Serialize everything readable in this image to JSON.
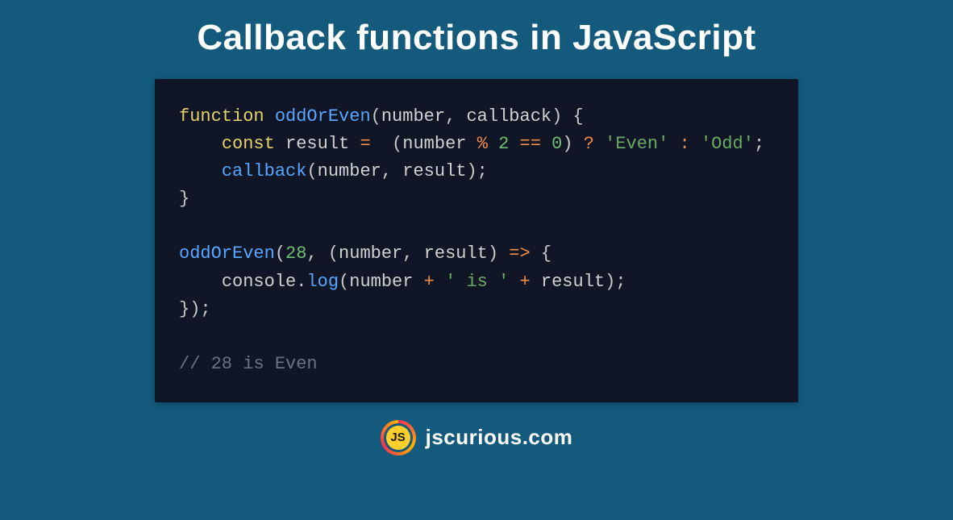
{
  "title": "Callback functions in JavaScript",
  "brand": {
    "badge": "JS",
    "domain": "jscurious.com"
  },
  "code": {
    "indent": "    ",
    "lines": [
      {
        "tokens": [
          {
            "t": "function ",
            "c": "kw"
          },
          {
            "t": "oddOrEven",
            "c": "fn"
          },
          {
            "t": "(",
            "c": "pn"
          },
          {
            "t": "number",
            "c": "id"
          },
          {
            "t": ", ",
            "c": "pn"
          },
          {
            "t": "callback",
            "c": "id"
          },
          {
            "t": ") {",
            "c": "pn"
          }
        ]
      },
      {
        "indent": 1,
        "tokens": [
          {
            "t": "const ",
            "c": "kw"
          },
          {
            "t": "result",
            "c": "id"
          },
          {
            "t": " ",
            "c": "pn"
          },
          {
            "t": "=",
            "c": "op"
          },
          {
            "t": "  (",
            "c": "pn"
          },
          {
            "t": "number",
            "c": "id"
          },
          {
            "t": " ",
            "c": "pn"
          },
          {
            "t": "%",
            "c": "op"
          },
          {
            "t": " ",
            "c": "pn"
          },
          {
            "t": "2",
            "c": "num"
          },
          {
            "t": " ",
            "c": "pn"
          },
          {
            "t": "==",
            "c": "op"
          },
          {
            "t": " ",
            "c": "pn"
          },
          {
            "t": "0",
            "c": "num"
          },
          {
            "t": ") ",
            "c": "pn"
          },
          {
            "t": "?",
            "c": "op"
          },
          {
            "t": " ",
            "c": "pn"
          },
          {
            "t": "'Even'",
            "c": "str"
          },
          {
            "t": " ",
            "c": "pn"
          },
          {
            "t": ":",
            "c": "op"
          },
          {
            "t": " ",
            "c": "pn"
          },
          {
            "t": "'Odd'",
            "c": "str"
          },
          {
            "t": ";",
            "c": "pn"
          }
        ]
      },
      {
        "indent": 1,
        "tokens": [
          {
            "t": "callback",
            "c": "fn"
          },
          {
            "t": "(",
            "c": "pn"
          },
          {
            "t": "number",
            "c": "id"
          },
          {
            "t": ", ",
            "c": "pn"
          },
          {
            "t": "result",
            "c": "id"
          },
          {
            "t": ");",
            "c": "pn"
          }
        ]
      },
      {
        "tokens": [
          {
            "t": "}",
            "c": "pn"
          }
        ]
      },
      {
        "tokens": []
      },
      {
        "tokens": [
          {
            "t": "oddOrEven",
            "c": "fn"
          },
          {
            "t": "(",
            "c": "pn"
          },
          {
            "t": "28",
            "c": "num"
          },
          {
            "t": ", (",
            "c": "pn"
          },
          {
            "t": "number",
            "c": "id"
          },
          {
            "t": ", ",
            "c": "pn"
          },
          {
            "t": "result",
            "c": "id"
          },
          {
            "t": ") ",
            "c": "pn"
          },
          {
            "t": "=>",
            "c": "op"
          },
          {
            "t": " {",
            "c": "pn"
          }
        ]
      },
      {
        "indent": 1,
        "tokens": [
          {
            "t": "console",
            "c": "id"
          },
          {
            "t": ".",
            "c": "pn"
          },
          {
            "t": "log",
            "c": "fn"
          },
          {
            "t": "(",
            "c": "pn"
          },
          {
            "t": "number",
            "c": "id"
          },
          {
            "t": " ",
            "c": "pn"
          },
          {
            "t": "+",
            "c": "op"
          },
          {
            "t": " ",
            "c": "pn"
          },
          {
            "t": "' is '",
            "c": "str"
          },
          {
            "t": " ",
            "c": "pn"
          },
          {
            "t": "+",
            "c": "op"
          },
          {
            "t": " ",
            "c": "pn"
          },
          {
            "t": "result",
            "c": "id"
          },
          {
            "t": ");",
            "c": "pn"
          }
        ]
      },
      {
        "tokens": [
          {
            "t": "});",
            "c": "pn"
          }
        ]
      },
      {
        "tokens": []
      },
      {
        "tokens": [
          {
            "t": "// 28 is Even",
            "c": "cm"
          }
        ]
      }
    ]
  }
}
